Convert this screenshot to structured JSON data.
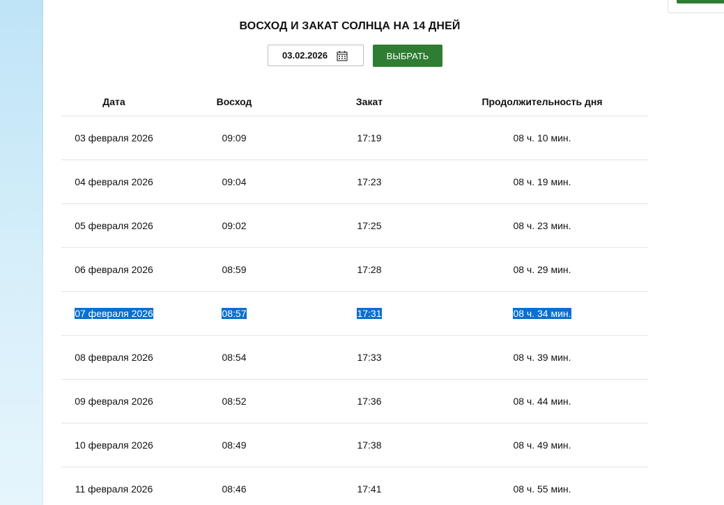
{
  "page": {
    "title": "ВОСХОД И ЗАКАТ СОЛНЦА НА 14 ДНЕЙ"
  },
  "controls": {
    "date_value": "03.02.2026",
    "select_label": "ВЫБРАТЬ"
  },
  "table": {
    "headers": [
      "Дата",
      "Восход",
      "Закат",
      "Продолжительность дня"
    ],
    "rows": [
      [
        "03 февраля 2026",
        "09:09",
        "17:19",
        "08 ч. 10 мин."
      ],
      [
        "04 февраля 2026",
        "09:04",
        "17:23",
        "08 ч. 19 мин."
      ],
      [
        "05 февраля 2026",
        "09:02",
        "17:25",
        "08 ч. 23 мин."
      ],
      [
        "06 февраля 2026",
        "08:59",
        "17:28",
        "08 ч. 29 мин."
      ],
      [
        "07 февраля 2026",
        "08:57",
        "17:31",
        "08 ч. 34 мин."
      ],
      [
        "08 февраля 2026",
        "08:54",
        "17:33",
        "08 ч. 39 мин."
      ],
      [
        "09 февраля 2026",
        "08:52",
        "17:36",
        "08 ч. 44 мин."
      ],
      [
        "10 февраля 2026",
        "08:49",
        "17:38",
        "08 ч. 49 мин."
      ],
      [
        "11 февраля 2026",
        "08:46",
        "17:41",
        "08 ч. 55 мин."
      ]
    ],
    "selected_row_index": 4
  },
  "colors": {
    "accent": "#2e7d32",
    "selection": "#0b6fcf",
    "background": "#bfe4f7"
  }
}
